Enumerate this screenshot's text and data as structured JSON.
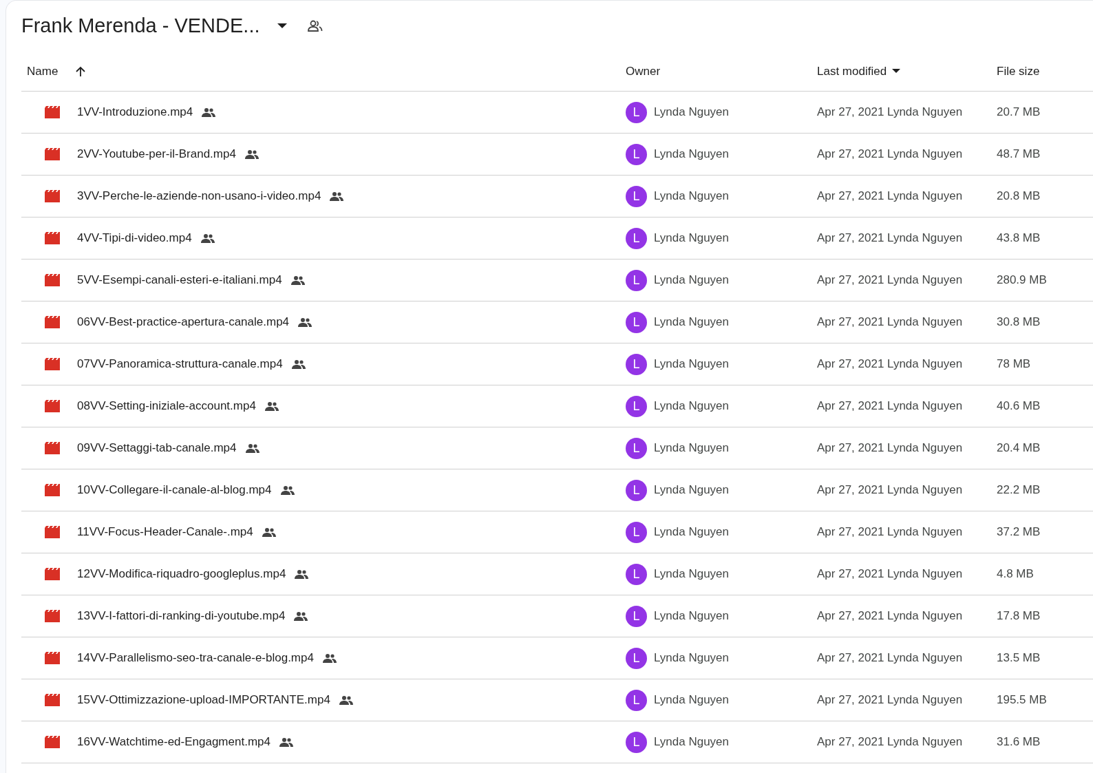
{
  "title": "Frank Merenda - VENDE...",
  "columns": [
    {
      "label": "Name",
      "sort_arrow": true,
      "menu_caret": false
    },
    {
      "label": "Owner",
      "sort_arrow": false,
      "menu_caret": false
    },
    {
      "label": "Last modified",
      "sort_arrow": false,
      "menu_caret": true
    },
    {
      "label": "File size",
      "sort_arrow": false,
      "menu_caret": false
    }
  ],
  "rows": [
    {
      "name": "1VV-Introduzione.mp4",
      "avatar": "L",
      "owner": "Lynda Nguyen",
      "modified": "Apr 27, 2021 Lynda Nguyen",
      "size": "20.7 MB"
    },
    {
      "name": "2VV-Youtube-per-il-Brand.mp4",
      "avatar": "L",
      "owner": "Lynda Nguyen",
      "modified": "Apr 27, 2021 Lynda Nguyen",
      "size": "48.7 MB"
    },
    {
      "name": "3VV-Perche-le-aziende-non-usano-i-video.mp4",
      "avatar": "L",
      "owner": "Lynda Nguyen",
      "modified": "Apr 27, 2021 Lynda Nguyen",
      "size": "20.8 MB"
    },
    {
      "name": "4VV-Tipi-di-video.mp4",
      "avatar": "L",
      "owner": "Lynda Nguyen",
      "modified": "Apr 27, 2021 Lynda Nguyen",
      "size": "43.8 MB"
    },
    {
      "name": "5VV-Esempi-canali-esteri-e-italiani.mp4",
      "avatar": "L",
      "owner": "Lynda Nguyen",
      "modified": "Apr 27, 2021 Lynda Nguyen",
      "size": "280.9 MB"
    },
    {
      "name": "06VV-Best-practice-apertura-canale.mp4",
      "avatar": "L",
      "owner": "Lynda Nguyen",
      "modified": "Apr 27, 2021 Lynda Nguyen",
      "size": "30.8 MB"
    },
    {
      "name": "07VV-Panoramica-struttura-canale.mp4",
      "avatar": "L",
      "owner": "Lynda Nguyen",
      "modified": "Apr 27, 2021 Lynda Nguyen",
      "size": "78 MB"
    },
    {
      "name": "08VV-Setting-iniziale-account.mp4",
      "avatar": "L",
      "owner": "Lynda Nguyen",
      "modified": "Apr 27, 2021 Lynda Nguyen",
      "size": "40.6 MB"
    },
    {
      "name": "09VV-Settaggi-tab-canale.mp4",
      "avatar": "L",
      "owner": "Lynda Nguyen",
      "modified": "Apr 27, 2021 Lynda Nguyen",
      "size": "20.4 MB"
    },
    {
      "name": "10VV-Collegare-il-canale-al-blog.mp4",
      "avatar": "L",
      "owner": "Lynda Nguyen",
      "modified": "Apr 27, 2021 Lynda Nguyen",
      "size": "22.2 MB"
    },
    {
      "name": "11VV-Focus-Header-Canale-.mp4",
      "avatar": "L",
      "owner": "Lynda Nguyen",
      "modified": "Apr 27, 2021 Lynda Nguyen",
      "size": "37.2 MB"
    },
    {
      "name": "12VV-Modifica-riquadro-googleplus.mp4",
      "avatar": "L",
      "owner": "Lynda Nguyen",
      "modified": "Apr 27, 2021 Lynda Nguyen",
      "size": "4.8 MB"
    },
    {
      "name": "13VV-I-fattori-di-ranking-di-youtube.mp4",
      "avatar": "L",
      "owner": "Lynda Nguyen",
      "modified": "Apr 27, 2021 Lynda Nguyen",
      "size": "17.8 MB"
    },
    {
      "name": "14VV-Parallelismo-seo-tra-canale-e-blog.mp4",
      "avatar": "L",
      "owner": "Lynda Nguyen",
      "modified": "Apr 27, 2021 Lynda Nguyen",
      "size": "13.5 MB"
    },
    {
      "name": "15VV-Ottimizzazione-upload-IMPORTANTE.mp4",
      "avatar": "L",
      "owner": "Lynda Nguyen",
      "modified": "Apr 27, 2021 Lynda Nguyen",
      "size": "195.5 MB"
    },
    {
      "name": "16VV-Watchtime-ed-Engagment.mp4",
      "avatar": "L",
      "owner": "Lynda Nguyen",
      "modified": "Apr 27, 2021 Lynda Nguyen",
      "size": "31.6 MB"
    }
  ]
}
